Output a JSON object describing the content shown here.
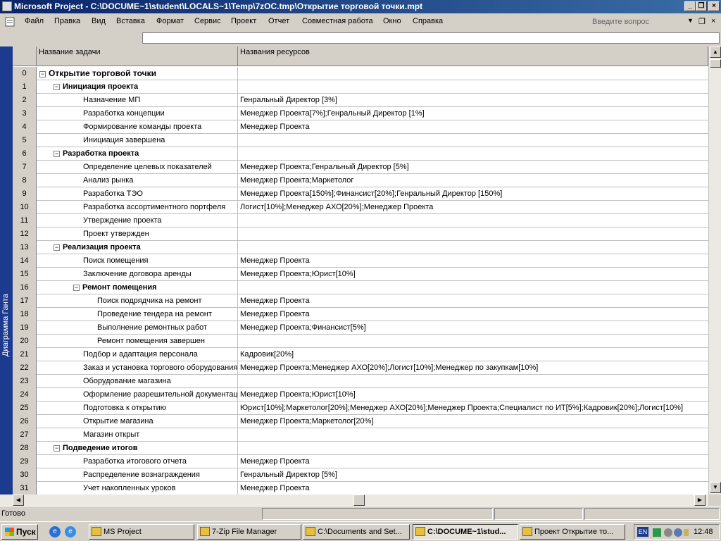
{
  "window": {
    "title": "Microsoft Project - C:\\DOCUME~1\\student\\LOCALS~1\\Temp\\7zOC.tmp\\Открытие торговой точки.mpt",
    "minimize_label": "_",
    "maximize_label": "❐",
    "close_label": "×"
  },
  "menu": {
    "items": [
      "Файл",
      "Правка",
      "Вид",
      "Вставка",
      "Формат",
      "Сервис",
      "Проект",
      "Отчет",
      "Совместная работа",
      "Окно",
      "Справка"
    ],
    "help_placeholder": "Введите вопрос",
    "help_arrow": "▼",
    "restore_label": "❐",
    "close_label": "×"
  },
  "view_bar": {
    "label": "Диаграмма Ганта"
  },
  "table": {
    "headers": {
      "name": "Название задачи",
      "resources": "Названия ресурсов"
    },
    "rows": [
      {
        "id": "0",
        "level": 0,
        "type": "project",
        "collapse": "−",
        "name": "Открытие торговой точки",
        "resources": ""
      },
      {
        "id": "1",
        "level": 1,
        "type": "summary",
        "collapse": "−",
        "name": "Инициация проекта",
        "resources": ""
      },
      {
        "id": "2",
        "level": 2,
        "type": "task",
        "name": "Назначение МП",
        "resources": "Генральный Директор [3%]"
      },
      {
        "id": "3",
        "level": 2,
        "type": "task",
        "name": "Разработка концепции",
        "resources": "Менеджер Проекта[7%];Генральный Директор [1%]"
      },
      {
        "id": "4",
        "level": 2,
        "type": "task",
        "name": "Формирование команды проекта",
        "resources": "Менеджер Проекта"
      },
      {
        "id": "5",
        "level": 2,
        "type": "task",
        "name": " Инициация завершена",
        "resources": ""
      },
      {
        "id": "6",
        "level": 1,
        "type": "summary",
        "collapse": "−",
        "name": "Разработка проекта",
        "resources": ""
      },
      {
        "id": "7",
        "level": 2,
        "type": "task",
        "name": "Определение целевых показателей",
        "resources": "Менеджер Проекта;Генральный Директор [5%]"
      },
      {
        "id": "8",
        "level": 2,
        "type": "task",
        "name": "Анализ рынка",
        "resources": "Менеджер Проекта;Маркетолог"
      },
      {
        "id": "9",
        "level": 2,
        "type": "task",
        "name": "Разработка ТЭО",
        "resources": "Менеджер Проекта[150%];Финансист[20%];Генральный Директор [150%]"
      },
      {
        "id": "10",
        "level": 2,
        "type": "task",
        "name": "Разработка ассортиментного портфеля",
        "resources": "Логист[10%];Менеджер АХО[20%];Менеджер Проекта"
      },
      {
        "id": "11",
        "level": 2,
        "type": "task",
        "name": "Утверждение проекта",
        "resources": ""
      },
      {
        "id": "12",
        "level": 2,
        "type": "task",
        "name": "Проект утвержден",
        "resources": ""
      },
      {
        "id": "13",
        "level": 1,
        "type": "summary",
        "collapse": "−",
        "name": "Реализация проекта",
        "resources": ""
      },
      {
        "id": "14",
        "level": 2,
        "type": "task",
        "name": "Поиск помещения",
        "resources": "Менеджер Проекта"
      },
      {
        "id": "15",
        "level": 2,
        "type": "task",
        "name": "Заключение договора аренды",
        "resources": "Менеджер Проекта;Юрист[10%]"
      },
      {
        "id": "16",
        "level": 2,
        "type": "summary",
        "collapse": "−",
        "name": "Ремонт помещения",
        "resources": ""
      },
      {
        "id": "17",
        "level": 3,
        "type": "task",
        "name": "Поиск подрядчика на ремонт",
        "resources": "Менеджер Проекта"
      },
      {
        "id": "18",
        "level": 3,
        "type": "task",
        "name": "Проведение тендера на ремонт",
        "resources": "Менеджер Проекта"
      },
      {
        "id": "19",
        "level": 3,
        "type": "task",
        "name": "Выполнение ремонтных работ",
        "resources": "Менеджер Проекта;Финансист[5%]"
      },
      {
        "id": "20",
        "level": 3,
        "type": "task",
        "name": "Ремонт помещения завершен",
        "resources": ""
      },
      {
        "id": "21",
        "level": 2,
        "type": "task",
        "name": "Подбор и адаптация персонала",
        "resources": "Кадровик[20%]"
      },
      {
        "id": "22",
        "level": 2,
        "type": "task",
        "name": "Заказ и установка торгового оборудования",
        "resources": "Менеджер Проекта;Менеджер АХО[20%];Логист[10%];Менеджер по закупкам[10%]"
      },
      {
        "id": "23",
        "level": 2,
        "type": "task",
        "name": "Оборудование магазина",
        "resources": ""
      },
      {
        "id": "24",
        "level": 2,
        "type": "task",
        "name": "Оформление разрешительной документации",
        "resources": "Менеджер Проекта;Юрист[10%]"
      },
      {
        "id": "25",
        "level": 2,
        "type": "task",
        "name": "Подготовка к открытию",
        "resources": "Юрист[10%];Маркетолог[20%];Менеджер АХО[20%];Менеджер Проекта;Специалист по ИТ[5%];Кадровик[20%];Логист[10%]"
      },
      {
        "id": "26",
        "level": 2,
        "type": "task",
        "name": "Открытие магазина",
        "resources": "Менеджер Проекта;Маркетолог[20%]"
      },
      {
        "id": "27",
        "level": 2,
        "type": "task",
        "name": "Магазин открыт",
        "resources": ""
      },
      {
        "id": "28",
        "level": 1,
        "type": "summary",
        "collapse": "−",
        "name": "Подведение итогов",
        "resources": ""
      },
      {
        "id": "29",
        "level": 2,
        "type": "task",
        "name": "Разработка итогового отчета",
        "resources": "Менеджер Проекта"
      },
      {
        "id": "30",
        "level": 2,
        "type": "task",
        "name": "Распределение вознаграждения",
        "resources": "Генральный Директор [5%]"
      },
      {
        "id": "31",
        "level": 2,
        "type": "task",
        "name": " Учет накопленных уроков",
        "resources": "Менеджер Проекта"
      }
    ]
  },
  "scroll": {
    "up": "▲",
    "down": "▼",
    "left": "◀",
    "right": "▶"
  },
  "status": {
    "text": "Готово"
  },
  "taskbar": {
    "start_label": "Пуск",
    "tasks": [
      {
        "label": "MS Project",
        "active": false
      },
      {
        "label": "7-Zip File Manager",
        "active": false
      },
      {
        "label": "C:\\Documents and Set...",
        "active": false
      },
      {
        "label": "C:\\DOCUME~1\\stud...",
        "active": true
      },
      {
        "label": "Проект Открытие то...",
        "active": false
      }
    ],
    "lang": "EN",
    "clock": "12:48"
  }
}
